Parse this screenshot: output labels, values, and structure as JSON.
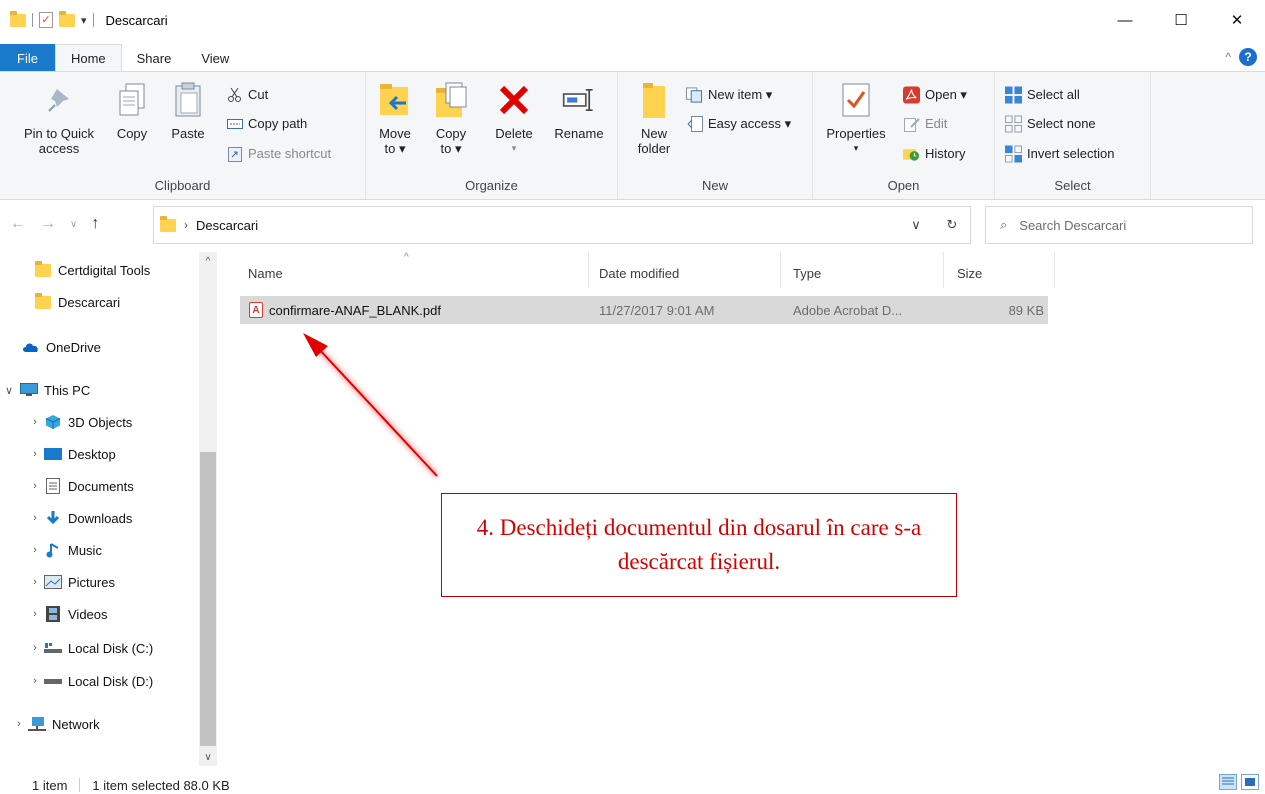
{
  "window": {
    "title": "Descarcari",
    "minimize_glyph": "—",
    "maximize_glyph": "☐",
    "close_glyph": "✕"
  },
  "tabs": [
    {
      "label": "File"
    },
    {
      "label": "Home"
    },
    {
      "label": "Share"
    },
    {
      "label": "View"
    }
  ],
  "ribbon": {
    "clipboard": {
      "label": "Clipboard",
      "pin": "Pin to Quick access",
      "copy": "Copy",
      "paste": "Paste",
      "cut": "Cut",
      "copy_path": "Copy path",
      "paste_shortcut": "Paste shortcut"
    },
    "organize": {
      "label": "Organize",
      "move_to": "Move to ▾",
      "copy_to": "Copy to ▾",
      "delete": "Delete",
      "rename": "Rename"
    },
    "new": {
      "label": "New",
      "new_folder": "New folder",
      "new_item": "New item ▾",
      "easy_access": "Easy access ▾"
    },
    "open": {
      "label": "Open",
      "properties": "Properties",
      "open": "Open ▾",
      "edit": "Edit",
      "history": "History"
    },
    "select": {
      "label": "Select",
      "select_all": "Select all",
      "select_none": "Select none",
      "invert_selection": "Invert selection"
    }
  },
  "address": {
    "crumb": "Descarcari",
    "search_placeholder": "Search Descarcari"
  },
  "sidebar": {
    "items": [
      {
        "label": "Certdigital Tools"
      },
      {
        "label": "Descarcari"
      },
      {
        "label": "OneDrive"
      },
      {
        "label": "This PC"
      },
      {
        "label": "3D Objects"
      },
      {
        "label": "Desktop"
      },
      {
        "label": "Documents"
      },
      {
        "label": "Downloads"
      },
      {
        "label": "Music"
      },
      {
        "label": "Pictures"
      },
      {
        "label": "Videos"
      },
      {
        "label": "Local Disk (C:)"
      },
      {
        "label": "Local Disk (D:)"
      },
      {
        "label": "Network"
      }
    ]
  },
  "columns": {
    "name": "Name",
    "date": "Date modified",
    "type": "Type",
    "size": "Size"
  },
  "files": [
    {
      "name": "confirmare-ANAF_BLANK.pdf",
      "date": "11/27/2017 9:01 AM",
      "type": "Adobe Acrobat D...",
      "size": "89 KB"
    }
  ],
  "annotation": {
    "text": "4. Deschideți documentul din dosarul în care s-a descărcat fișierul.",
    "color": "#d40000"
  },
  "status": {
    "count": "1 item",
    "selected": "1 item selected  88.0 KB"
  },
  "colors": {
    "file_tab": "#1979ca",
    "ribbon_bg": "#f5f6f7",
    "selected_row": "#d9d9d9"
  }
}
